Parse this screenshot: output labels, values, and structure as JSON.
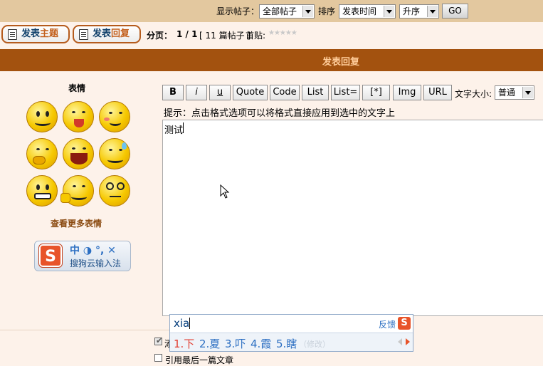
{
  "filters": {
    "show_posts_label": "显示帖子：",
    "show_posts_value": "全部帖子",
    "sort_label": "排序",
    "sort_value": "发表时间",
    "order_value": "升序",
    "go_label": "GO"
  },
  "actions": {
    "new_topic_a": "发表",
    "new_topic_b": "主题",
    "reply_a": "发表",
    "reply_b": "回复",
    "pages_label": "分页：",
    "pages_value": "1 / 1",
    "post_count": "[ 11 篇帖子 ]",
    "first_post_label": "首贴:",
    "rating_stars": "★★★★★"
  },
  "section": {
    "title": "发表回复"
  },
  "emoticons": {
    "heading": "表情",
    "more_link": "查看更多表情"
  },
  "sogou": {
    "status_glyphs": "中 ◑ °, ✕",
    "name": "搜狗云输入法",
    "logo": "S"
  },
  "toolbar": {
    "buttons": [
      "B",
      "i",
      "u",
      "Quote",
      "Code",
      "List",
      "List=",
      "[*]",
      "Img",
      "URL"
    ],
    "font_size_label": "文字大小:",
    "font_size_value": "普通"
  },
  "hint": {
    "text": "提示：点击格式选项可以将格式直接应用到选中的文字上"
  },
  "editor": {
    "content": "测试"
  },
  "ime": {
    "input": "xia",
    "feedback": "反馈",
    "candidates": [
      "1.下",
      "2.夏",
      "3.吓",
      "4.霞",
      "5.瞎"
    ],
    "hidden_text": "（修改）"
  },
  "options": {
    "quote_last": "引用最后一篇文章"
  },
  "colors": {
    "header_bar": "#a3520f",
    "filter_bar": "#e3c89f",
    "page_bg": "#fdf2ea",
    "candidate_first": "#e23b2e",
    "candidate_rest": "#2c6fc2"
  }
}
